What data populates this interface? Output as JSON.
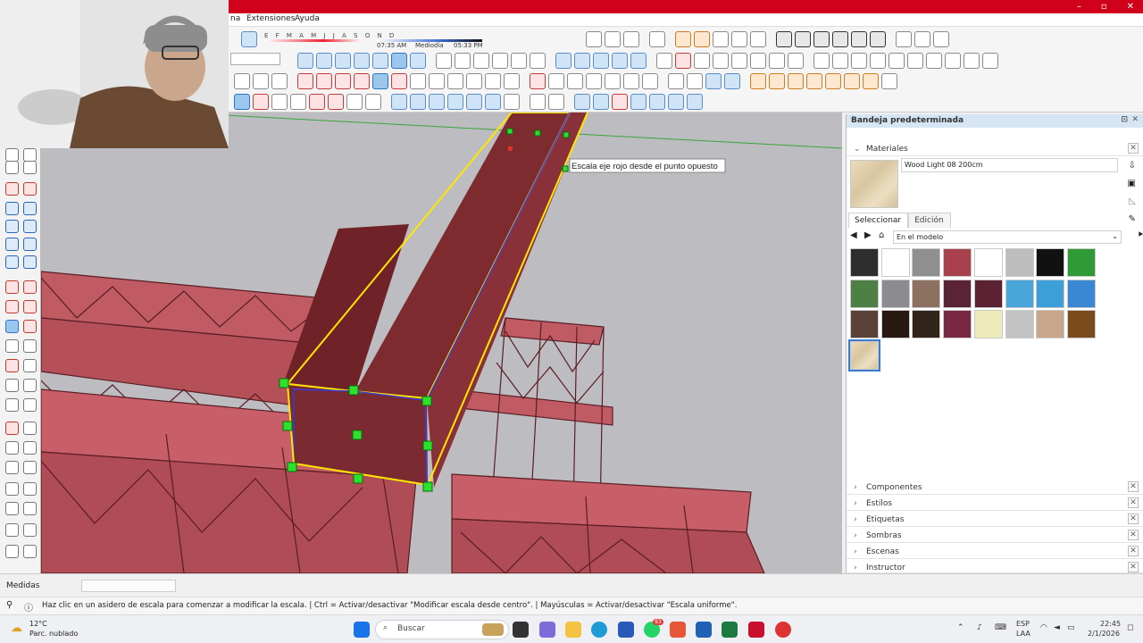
{
  "menu": {
    "item_na": "na",
    "extensions": "Extensiones",
    "help": "Ayuda"
  },
  "shadows": {
    "months": "E F M A M J J A S O N D",
    "time_start": "07:35 AM",
    "mid": "Mediodía",
    "time_end": "05:33 PM"
  },
  "tooltip": "Escala eje rojo desde el punto opuesto",
  "tray": {
    "title": "Bandeja predeterminada",
    "materials_header": "Materiales",
    "material_name": "Wood Light 08 200cm",
    "tab_select": "Seleccionar",
    "tab_edit": "Edición",
    "collection": "En el modelo",
    "swatch_colors": [
      "#2e2e2e",
      "#ffffff",
      "#8f8f8f",
      "#a8414b",
      "#ffffff",
      "#bdbdbd",
      "#111111",
      "#2f9a36",
      "#4e7f45",
      "#8c8b90",
      "#8e7060",
      "#5a2436",
      "#5c2132",
      "#4aa6da",
      "#3c9fd8",
      "#3a87d3",
      "#5a4238",
      "#271812",
      "#31241a",
      "#7a2744",
      "#ecebb9",
      "#c2c2c2",
      "#c7a68b",
      "#7b4a1d",
      "#e1d3b3"
    ],
    "panels": [
      "Componentes",
      "Estilos",
      "Etiquetas",
      "Sombras",
      "Escenas",
      "Instructor"
    ]
  },
  "status": {
    "measures_label": "Medidas",
    "hint": "Haz clic en un asidero de escala para comenzar a modificar la escala. | Ctrl = Activar/desactivar \"Modificar escala desde centro\". | Mayúsculas = Activar/desactivar \"Escala uniforme\"."
  },
  "taskbar": {
    "weather_temp": "12°C",
    "weather_desc": "Parc. nublado",
    "search": "Buscar",
    "badge": "93",
    "lang1": "ESP",
    "lang2": "LAA",
    "time": "22:45",
    "date": "2/1/2026"
  },
  "colors": {
    "accent_red": "#d0021b",
    "beam": "#7d2b2f",
    "truss": "#b5505a",
    "selection": "#ffe600",
    "grip": "#22dd22"
  }
}
